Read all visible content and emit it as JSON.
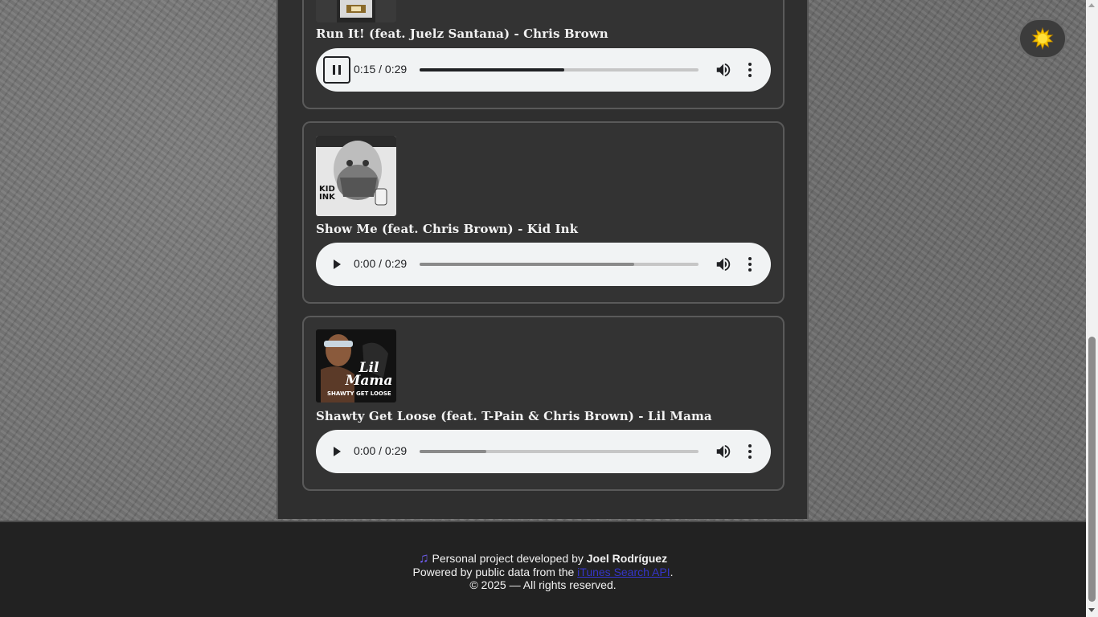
{
  "theme_toggle": {
    "icon": "sun-icon"
  },
  "tracks": [
    {
      "title": "Run It! (feat. Juelz Santana) - Chris Brown",
      "cover_icon": "album-cover-run-it",
      "state": "playing",
      "time": "0:15 / 0:29",
      "progress": 0.52,
      "buffered": 0.52
    },
    {
      "title": "Show Me (feat. Chris Brown) - Kid Ink",
      "cover_icon": "album-cover-kid-ink",
      "cover_text": "KID INK",
      "state": "paused",
      "time": "0:00 / 0:29",
      "progress": 0,
      "buffered": 0.77
    },
    {
      "title": "Shawty Get Loose (feat. T-Pain & Chris Brown) - Lil Mama",
      "cover_icon": "album-cover-lil-mama",
      "cover_text": "Lil Mama",
      "cover_subtext": "SHAWTY GET LOOSE",
      "state": "paused",
      "time": "0:00 / 0:29",
      "progress": 0,
      "buffered": 0.24
    }
  ],
  "footer": {
    "icon": "music-note-icon",
    "line1_prefix": "Personal project developed by",
    "author": "Joel Rodríguez",
    "line2_prefix": "Powered by public data from the",
    "api_link": "iTunes Search API",
    "line2_suffix": ".",
    "copyright": "© 2025 — All rights reserved."
  },
  "colors": {
    "accent_link": "#3535c8",
    "card_bg": "#333333",
    "player_bg": "#f1f3f4"
  }
}
